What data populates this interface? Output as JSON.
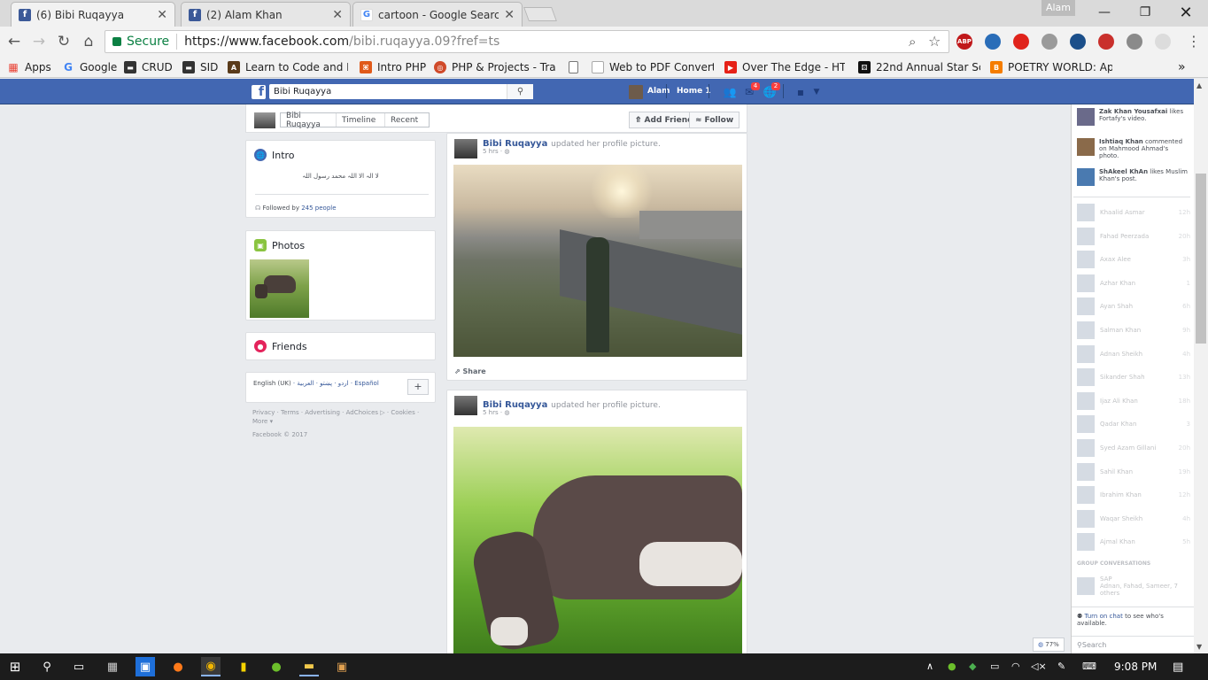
{
  "browser": {
    "tabs": [
      {
        "title": "(6) Bibi Ruqayya",
        "icon": "facebook-icon",
        "active": true
      },
      {
        "title": "(2) Alam Khan",
        "icon": "facebook-icon",
        "active": false
      },
      {
        "title": "cartoon - Google Search",
        "icon": "google-icon",
        "active": false
      }
    ],
    "profile_name": "Alam",
    "omnibox": {
      "secure_label": "Secure",
      "url_host": "https://www.facebook.com",
      "url_path": "/bibi.ruqayya.09?fref=ts"
    },
    "extensions": [
      {
        "name": "adblock-icon",
        "label": "ABP",
        "color": "#c0181a"
      },
      {
        "name": "globe-ext-icon",
        "label": "",
        "color": "#2a6db8"
      },
      {
        "name": "opera-icon",
        "label": "",
        "color": "#e0231b"
      },
      {
        "name": "world-ext-icon",
        "label": "",
        "color": "#9a9a9a"
      },
      {
        "name": "chart-ext-icon",
        "label": "",
        "color": "#1b4f8a"
      },
      {
        "name": "pdf-ext-icon",
        "label": "",
        "color": "#c9302c"
      },
      {
        "name": "cloud-ext-icon",
        "label": "",
        "color": "#8a8a8a"
      },
      {
        "name": "grey-ext-icon",
        "label": "",
        "color": "#dcdcdc"
      }
    ],
    "bookmarks": [
      {
        "label": "Apps",
        "icon": "apps-grid-icon",
        "color": "#e94235"
      },
      {
        "label": "Google",
        "icon": "google-icon",
        "color": "#4285f4"
      },
      {
        "label": "CRUD",
        "icon": "crud-icon",
        "color": "#333333"
      },
      {
        "label": "SID",
        "icon": "sid-icon",
        "color": "#333333"
      },
      {
        "label": "Learn to Code and He",
        "icon": "code-icon",
        "color": "#5a3b1a"
      },
      {
        "label": "Intro PHP",
        "icon": "php-icon",
        "color": "#e05a1a"
      },
      {
        "label": "PHP & Projects - Train",
        "icon": "projects-icon",
        "color": "#d04a2a"
      },
      {
        "label": "",
        "icon": "page-icon",
        "color": "#ffffff"
      },
      {
        "label": "Web to PDF Converte",
        "icon": "pdf-page-icon",
        "color": "#ffffff"
      },
      {
        "label": "Over The Edge - HTV",
        "icon": "youtube-icon",
        "color": "#e62117"
      },
      {
        "label": "22nd Annual Star Scre",
        "icon": "dice-icon",
        "color": "#111111"
      },
      {
        "label": "POETRY WORLD: Apri",
        "icon": "blogger-icon",
        "color": "#f57d00"
      }
    ]
  },
  "fb": {
    "search_value": "Bibi Ruqayya",
    "user_name": "Alam",
    "home_label": "Home",
    "home_count": "1",
    "notif_messages": "4",
    "notif_world": "2",
    "timeline_tabs": [
      "Bibi Ruqayya",
      "Timeline",
      "Recent"
    ],
    "add_friend": "Add Friend",
    "follow": "Follow",
    "intro": {
      "title": "Intro",
      "bio": "لا الہ الا اللہ محمد رسول اللہ",
      "followed_prefix": "Followed by ",
      "followed_link": "245 people"
    },
    "photos_title": "Photos",
    "friends_title": "Friends",
    "languages": {
      "current": "English (UK)",
      "others": "· اردو · پښتو · العربية ·",
      "spanish": "Español",
      "add": "+"
    },
    "footer_links": "Privacy · Terms · Advertising · AdChoices ▷ · Cookies · More ▾",
    "copyright": "Facebook © 2017",
    "posts": [
      {
        "name": "Bibi Ruqayya",
        "action": "updated her profile picture.",
        "time": "5 hrs · ",
        "share": "Share"
      },
      {
        "name": "Bibi Ruqayya",
        "action": "updated her profile picture.",
        "time": "5 hrs · "
      }
    ],
    "ticker": [
      {
        "name": "Zak Khan Yousafxai",
        "text": " likes Fortafy's video."
      },
      {
        "name": "Ishtiaq Khan",
        "text": " commented on Mahmood Ahmad's photo."
      },
      {
        "name": "ShAkeel KhAn",
        "text": " likes Muslim Khan's post."
      }
    ],
    "chat": [
      {
        "name": "Khaalid Asmar",
        "time": "12h"
      },
      {
        "name": "Fahad Peerzada",
        "time": "20h"
      },
      {
        "name": "Axax Alee",
        "time": "3h"
      },
      {
        "name": "Azhar Khan",
        "time": "1"
      },
      {
        "name": "Ayan Shah",
        "time": "6h"
      },
      {
        "name": "Salman Khan",
        "time": "9h"
      },
      {
        "name": "Adnan Sheikh",
        "time": "4h"
      },
      {
        "name": "Sikander Shah",
        "time": "13h"
      },
      {
        "name": "Ijaz Ali Khan",
        "time": "18h"
      },
      {
        "name": "Qadar Khan",
        "time": "3"
      },
      {
        "name": "Syed Azam Gillani",
        "time": "20h"
      },
      {
        "name": "Sahil Khan",
        "time": "19h"
      },
      {
        "name": "Ibrahim Khan",
        "time": "12h"
      },
      {
        "name": "Waqar Sheikh",
        "time": "4h"
      },
      {
        "name": "Ajmal Khan",
        "time": "5h"
      }
    ],
    "group_conv_label": "GROUP CONVERSATIONS",
    "group": {
      "name": "SAP",
      "members": "Adnan, Fahad, Sameer, 7 others"
    },
    "chat_off_link": "Turn on chat",
    "chat_off_text": " to see who's available.",
    "chat_search": "Search",
    "chat_pct": "77%"
  },
  "taskbar": {
    "time": "9:08 PM"
  }
}
